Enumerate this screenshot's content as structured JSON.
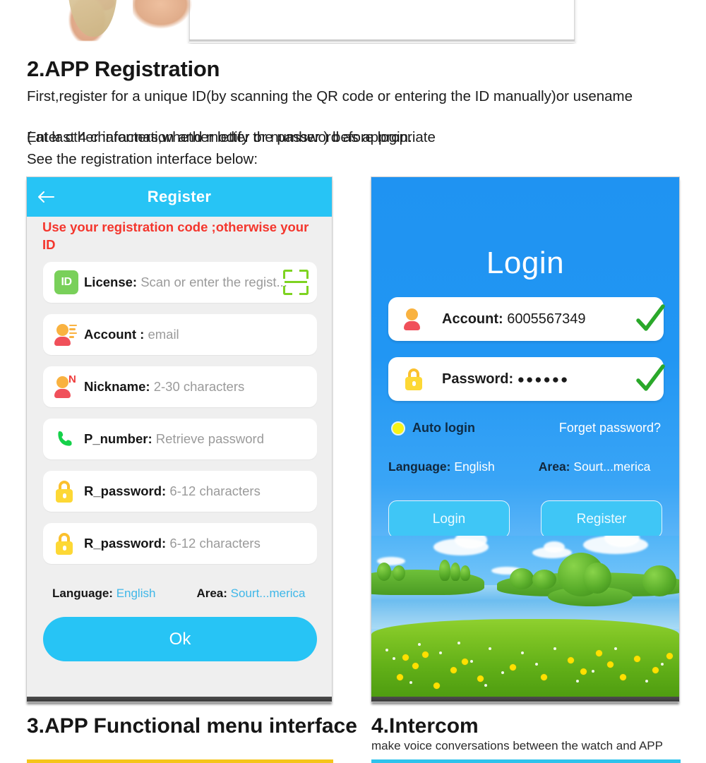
{
  "section": {
    "heading": "2.APP Registration",
    "paragraph_1": "First,register for a unique ID(by scanning the QR code or entering the ID manually)or usename",
    "paragraph_2": "( at last 4 characters,whether letter or number ) before login.",
    "paragraph_3": "Enter other information and modify the password as appropriate",
    "paragraph_4": "See the registration interface below:"
  },
  "register_screen": {
    "title": "Register",
    "back_icon": "back-arrow-icon",
    "warning": "Use your registration code ;otherwise your ID",
    "fields": [
      {
        "icon": "id-badge-icon",
        "icon_text": "ID",
        "label": "License:",
        "placeholder": "Scan or enter the regist...",
        "trailing_icon": "qr-scan-icon"
      },
      {
        "icon": "person-account-icon",
        "label": "Account :",
        "placeholder": "email"
      },
      {
        "icon": "person-nickname-icon",
        "badge": "N",
        "label": "Nickname:",
        "placeholder": "2-30 characters"
      },
      {
        "icon": "phone-icon",
        "label": "P_number:",
        "placeholder": "Retrieve password"
      },
      {
        "icon": "lock-icon",
        "label": "R_password:",
        "placeholder": "6-12 characters"
      },
      {
        "icon": "lock-icon",
        "label": "R_password:",
        "placeholder": "6-12 characters"
      }
    ],
    "language_label": "Language:",
    "language_value": "English",
    "area_label": "Area:",
    "area_value": "Sourt...merica",
    "ok_button": "Ok"
  },
  "login_screen": {
    "title": "Login",
    "account_label": "Account:",
    "account_value": "6005567349",
    "account_icon": "person-account-icon",
    "account_status_icon": "green-check-icon",
    "password_label": "Password:",
    "password_value": "●●●●●●",
    "password_icon": "lock-icon",
    "password_status_icon": "green-check-icon",
    "auto_login_label": "Auto login",
    "auto_login_checked": true,
    "forget_password": "Forget password?",
    "language_label": "Language:",
    "language_value": "English",
    "area_label": "Area:",
    "area_value": "Sourt...merica",
    "login_button": "Login",
    "register_button": "Register"
  },
  "footer": {
    "heading_3": "3.APP Functional menu interface",
    "heading_4": "4.Intercom",
    "subtitle_4": "make voice conversations between the watch and APP"
  },
  "colors": {
    "header_cyan": "#27c4f5",
    "login_blue": "#2196f3",
    "warning_red": "#f4362d",
    "accent_link": "#3fb7e8",
    "bar_yellow": "#f5c51a",
    "bar_cyan": "#2ec3ec",
    "check_green": "#2aa82a",
    "radio_yellow": "#f7f318"
  }
}
